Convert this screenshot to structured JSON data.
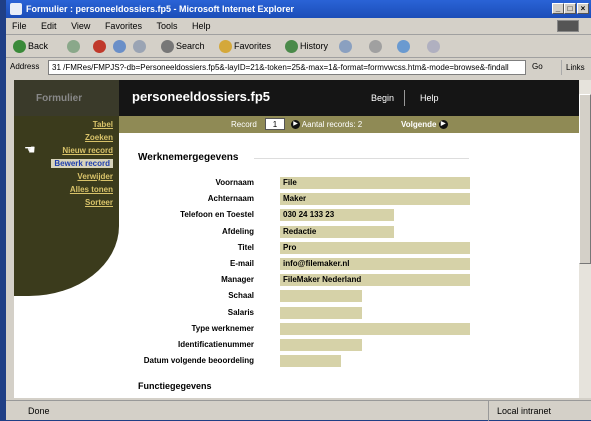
{
  "window": {
    "title": "Formulier : personeeldossiers.fp5 - Microsoft Internet Explorer",
    "controls": [
      "_",
      "□",
      "×"
    ]
  },
  "menu": [
    "File",
    "Edit",
    "View",
    "Favorites",
    "Tools",
    "Help"
  ],
  "toolbar": {
    "back": "Back",
    "search": "Search",
    "favorites": "Favorites",
    "history": "History"
  },
  "address": {
    "label": "Address",
    "url": "31 /FMRes/FMPJS?-db=Personeeldossiers.fp5&-layID=21&-token=25&-max=1&-format=formvwcss.htm&-mode=browse&-findall",
    "go": "Go",
    "links": "Links"
  },
  "fm": {
    "brand": "Formulier",
    "db_name": "personeeldossiers.fp5",
    "begin": "Begin",
    "help": "Help"
  },
  "recordbar": {
    "record_label": "Record",
    "record_value": "1",
    "count": "Aantal records: 2",
    "next": "Volgende"
  },
  "sidebar": {
    "items": [
      {
        "label": "Tabel",
        "active": false
      },
      {
        "label": "Zoeken",
        "active": false
      },
      {
        "label": "Nieuw record",
        "active": false
      },
      {
        "label": "Bewerk record",
        "active": true
      },
      {
        "label": "Verwijder",
        "active": false
      },
      {
        "label": "Alles tonen",
        "active": false
      },
      {
        "label": "Sorteer",
        "active": false
      }
    ]
  },
  "form": {
    "section_title": "Werknemergegevens",
    "fields": [
      {
        "label": "Voornaam",
        "value": "File",
        "fill": 1.0
      },
      {
        "label": "Achternaam",
        "value": "Maker",
        "fill": 1.0
      },
      {
        "label": "Telefoon en Toestel",
        "value": "030 24 133 23",
        "fill": 0.6
      },
      {
        "label": "Afdeling",
        "value": "Redactie",
        "fill": 0.6
      },
      {
        "label": "Titel",
        "value": "Pro",
        "fill": 1.0
      },
      {
        "label": "E-mail",
        "value": "info@filemaker.nl",
        "fill": 1.0
      },
      {
        "label": "Manager",
        "value": "FileMaker Nederland",
        "fill": 1.0
      },
      {
        "label": "Schaal",
        "value": "",
        "fill": 0.43
      },
      {
        "label": "Salaris",
        "value": "",
        "fill": 0.43
      },
      {
        "label": "Type werknemer",
        "value": "",
        "fill": 1.0
      },
      {
        "label": "Identificatienummer",
        "value": "",
        "fill": 0.43
      },
      {
        "label": "Datum volgende beoordeling",
        "value": "",
        "fill": 0.32
      }
    ],
    "section2_title": "Functiegegevens"
  },
  "status": {
    "text": "Done",
    "zone": "Local intranet"
  }
}
